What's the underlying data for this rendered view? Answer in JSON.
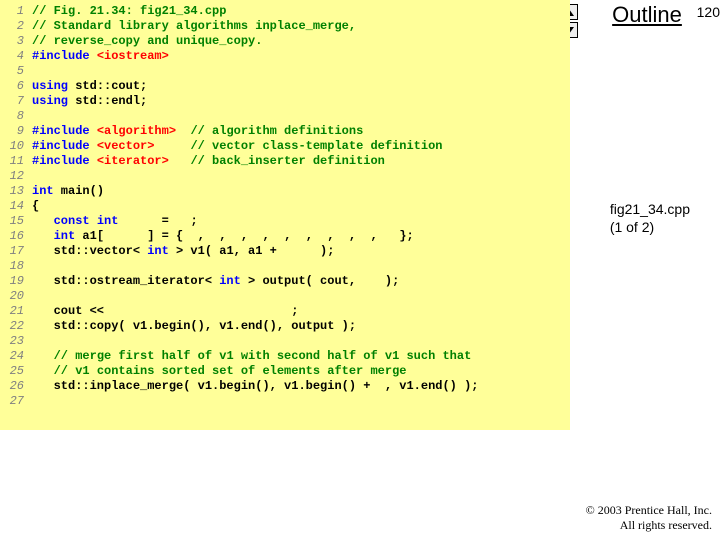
{
  "page_number": "120",
  "outline_label": "Outline",
  "caption_line1": "fig21_34.cpp",
  "caption_line2": "(1 of 2)",
  "footer_line1": "© 2003 Prentice Hall, Inc.",
  "footer_line2": "All rights reserved.",
  "code": [
    {
      "n": "1",
      "spans": [
        [
          "g",
          "// Fig. 21.34: fig21_34.cpp"
        ]
      ]
    },
    {
      "n": "2",
      "spans": [
        [
          "g",
          "// Standard library algorithms inplace_merge,"
        ]
      ]
    },
    {
      "n": "3",
      "spans": [
        [
          "g",
          "// reverse_copy and unique_copy."
        ]
      ]
    },
    {
      "n": "4",
      "spans": [
        [
          "b",
          "#include "
        ],
        [
          "r",
          "<iostream>"
        ]
      ]
    },
    {
      "n": "5",
      "spans": [
        [
          "k",
          ""
        ]
      ]
    },
    {
      "n": "6",
      "spans": [
        [
          "b",
          "using "
        ],
        [
          "k",
          "std::cout;"
        ]
      ]
    },
    {
      "n": "7",
      "spans": [
        [
          "b",
          "using "
        ],
        [
          "k",
          "std::endl;"
        ]
      ]
    },
    {
      "n": "8",
      "spans": [
        [
          "k",
          ""
        ]
      ]
    },
    {
      "n": "9",
      "spans": [
        [
          "b",
          "#include "
        ],
        [
          "r",
          "<algorithm>"
        ],
        [
          "k",
          "  "
        ],
        [
          "g",
          "// algorithm definitions"
        ]
      ]
    },
    {
      "n": "10",
      "spans": [
        [
          "b",
          "#include "
        ],
        [
          "r",
          "<vector>"
        ],
        [
          "k",
          "     "
        ],
        [
          "g",
          "// vector class-template definition"
        ]
      ]
    },
    {
      "n": "11",
      "spans": [
        [
          "b",
          "#include "
        ],
        [
          "r",
          "<iterator>"
        ],
        [
          "k",
          "   "
        ],
        [
          "g",
          "// back_inserter definition"
        ]
      ]
    },
    {
      "n": "12",
      "spans": [
        [
          "k",
          ""
        ]
      ]
    },
    {
      "n": "13",
      "spans": [
        [
          "b",
          "int"
        ],
        [
          "k",
          " main()"
        ]
      ]
    },
    {
      "n": "14",
      "spans": [
        [
          "k",
          "{"
        ]
      ]
    },
    {
      "n": "15",
      "spans": [
        [
          "k",
          "   "
        ],
        [
          "b",
          "const int"
        ],
        [
          "k",
          "      = "
        ],
        [
          "t",
          "  "
        ],
        [
          "k",
          ";"
        ]
      ]
    },
    {
      "n": "16",
      "spans": [
        [
          "k",
          "   "
        ],
        [
          "b",
          "int"
        ],
        [
          "k",
          " a1[      ] = { "
        ],
        [
          "t",
          " "
        ],
        [
          "k",
          ", "
        ],
        [
          "t",
          " "
        ],
        [
          "k",
          ", "
        ],
        [
          "t",
          " "
        ],
        [
          "k",
          ", "
        ],
        [
          "t",
          " "
        ],
        [
          "k",
          ", "
        ],
        [
          "t",
          " "
        ],
        [
          "k",
          ", "
        ],
        [
          "t",
          " "
        ],
        [
          "k",
          ", "
        ],
        [
          "t",
          " "
        ],
        [
          "k",
          ", "
        ],
        [
          "t",
          " "
        ],
        [
          "k",
          ", "
        ],
        [
          "t",
          " "
        ],
        [
          "k",
          ", "
        ],
        [
          "t",
          " "
        ],
        [
          "k",
          " };"
        ]
      ]
    },
    {
      "n": "17",
      "spans": [
        [
          "k",
          "   std::vector< "
        ],
        [
          "b",
          "int"
        ],
        [
          "k",
          " > v1( a1, a1 +      );"
        ]
      ]
    },
    {
      "n": "18",
      "spans": [
        [
          "k",
          ""
        ]
      ]
    },
    {
      "n": "19",
      "spans": [
        [
          "k",
          "   std::ostream_iterator< "
        ],
        [
          "b",
          "int"
        ],
        [
          "k",
          " > output( cout, "
        ],
        [
          "r",
          "   "
        ],
        [
          "k",
          ");"
        ]
      ]
    },
    {
      "n": "20",
      "spans": [
        [
          "k",
          ""
        ]
      ]
    },
    {
      "n": "21",
      "spans": [
        [
          "k",
          "   cout << "
        ],
        [
          "r",
          "                         "
        ],
        [
          "k",
          ";"
        ]
      ]
    },
    {
      "n": "22",
      "spans": [
        [
          "k",
          "   std::copy( v1.begin(), v1.end(), output );"
        ]
      ]
    },
    {
      "n": "23",
      "spans": [
        [
          "k",
          ""
        ]
      ]
    },
    {
      "n": "24",
      "spans": [
        [
          "k",
          "   "
        ],
        [
          "g",
          "// merge first half of v1 with second half of v1 such that"
        ]
      ]
    },
    {
      "n": "25",
      "spans": [
        [
          "k",
          "   "
        ],
        [
          "g",
          "// v1 contains sorted set of elements after merge"
        ]
      ]
    },
    {
      "n": "26",
      "spans": [
        [
          "k",
          "   std::inplace_merge( v1.begin(), v1.begin() + "
        ],
        [
          "t",
          " "
        ],
        [
          "k",
          ", v1.end() );"
        ]
      ]
    },
    {
      "n": "27",
      "spans": [
        [
          "k",
          ""
        ]
      ]
    }
  ]
}
